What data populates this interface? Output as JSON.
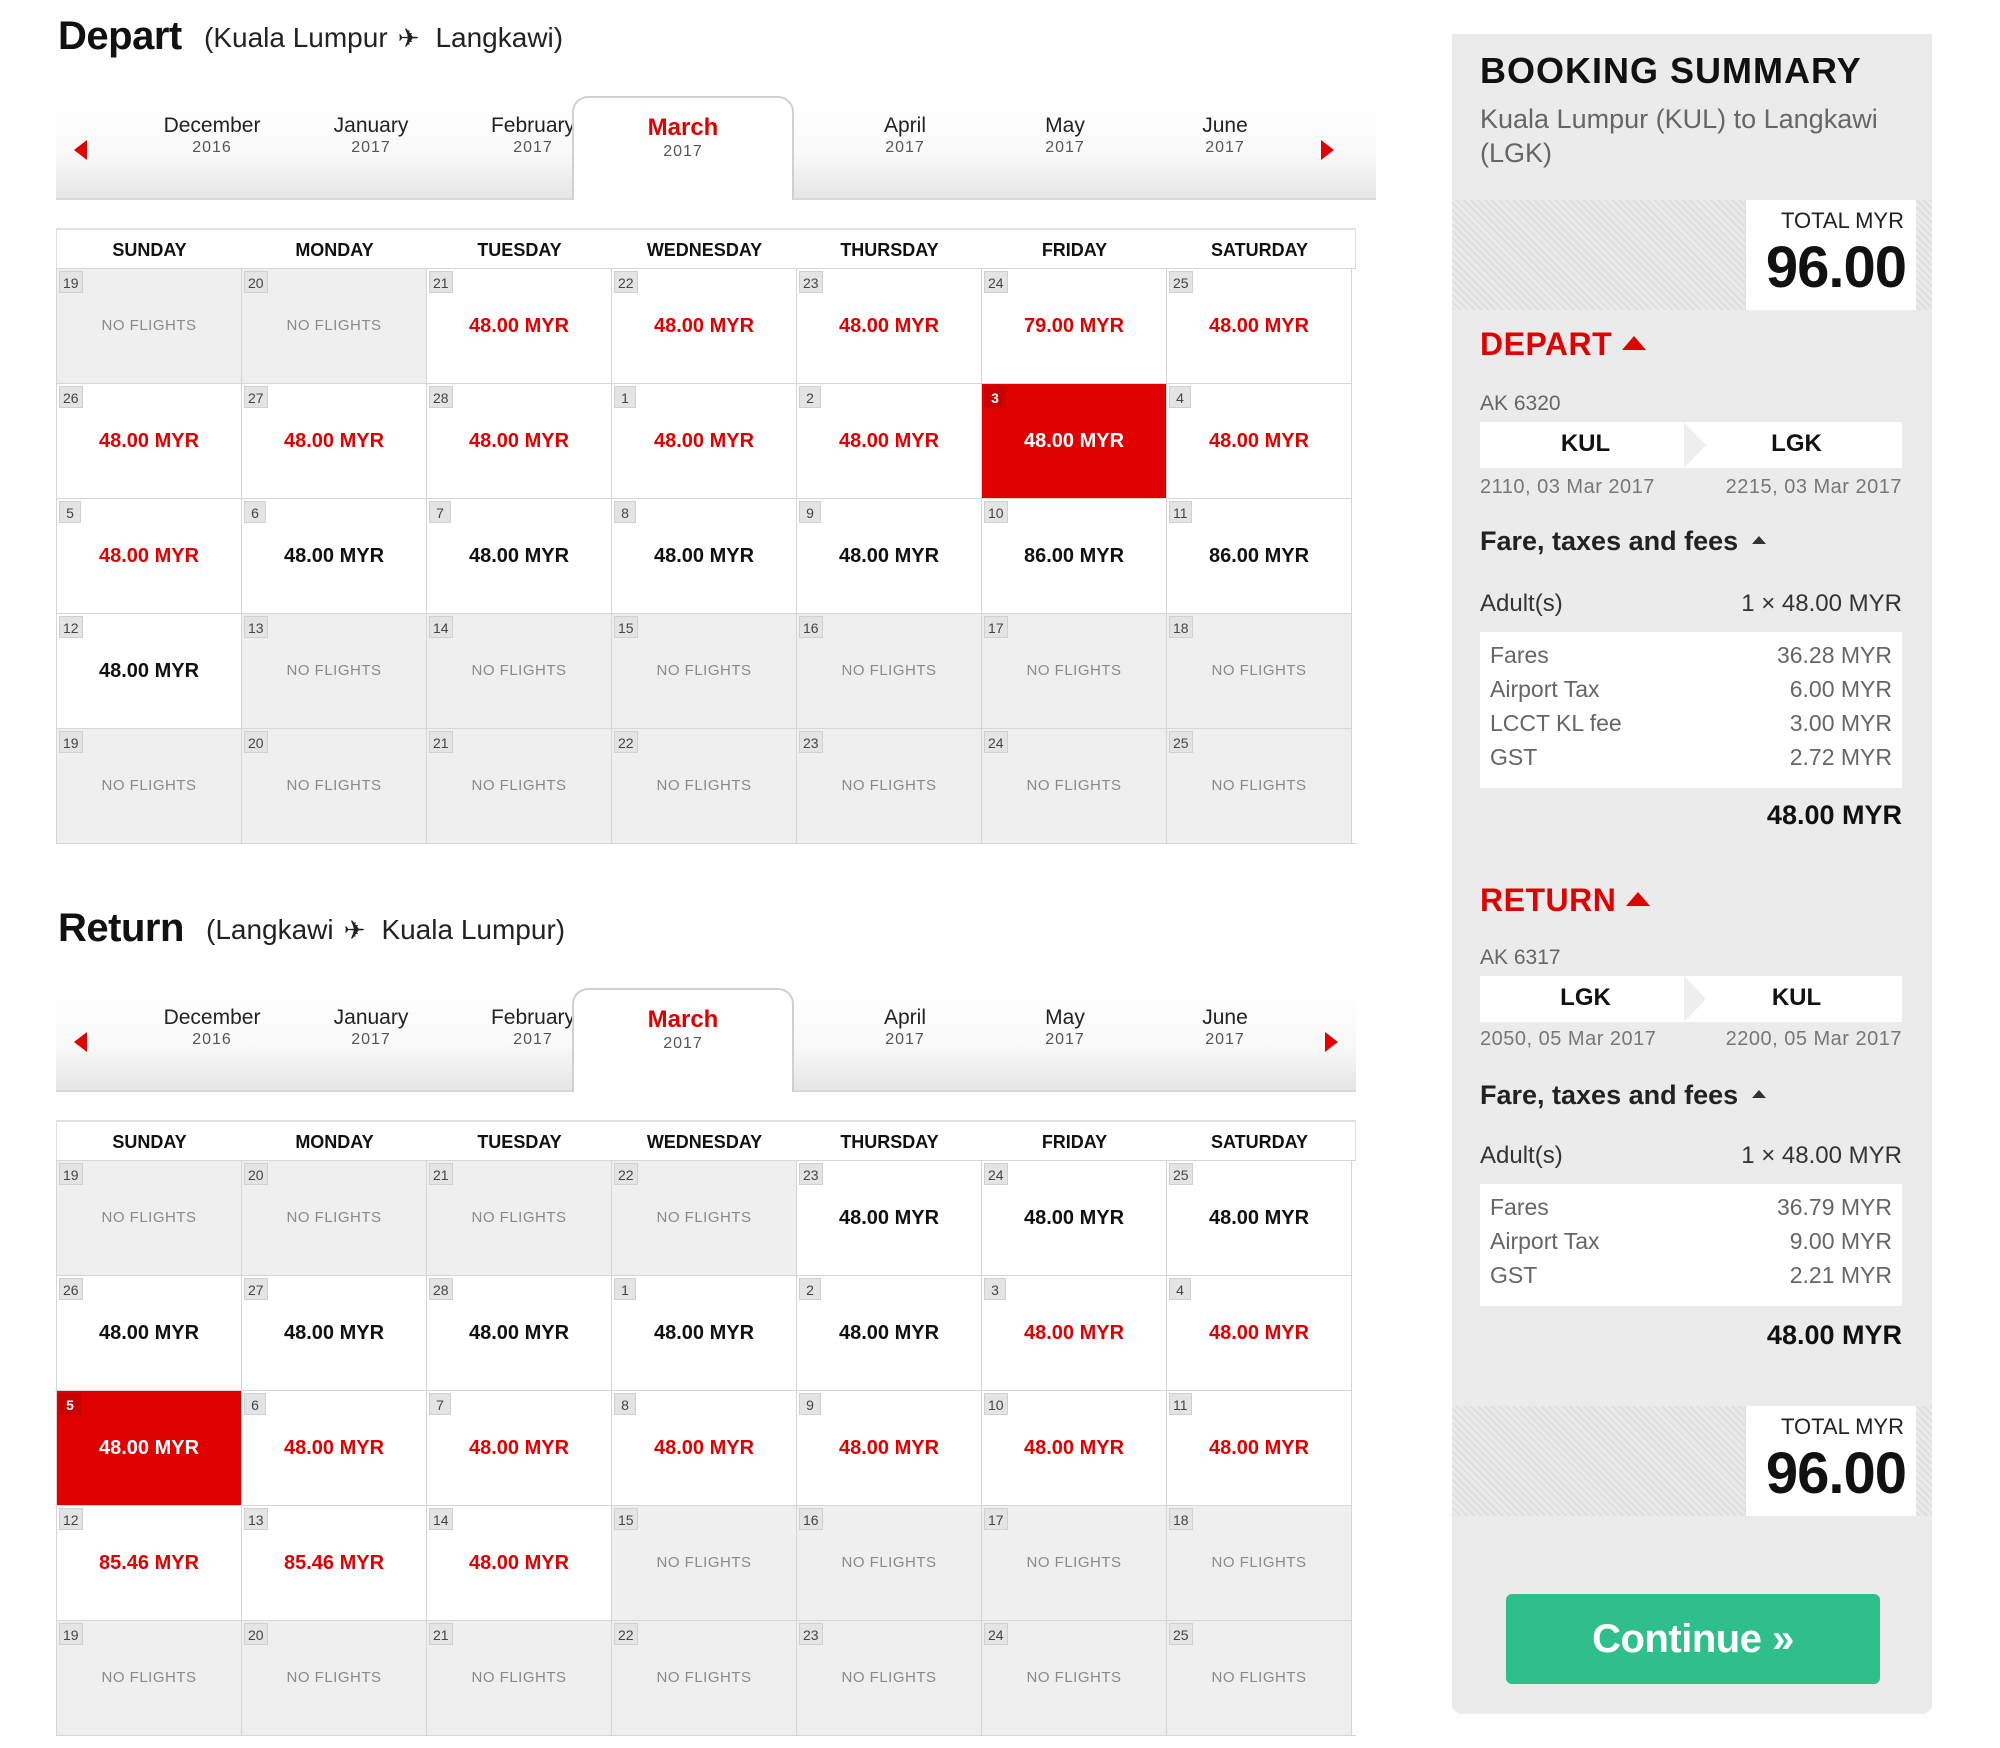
{
  "weekdays": [
    "SUNDAY",
    "MONDAY",
    "TUESDAY",
    "WEDNESDAY",
    "THURSDAY",
    "FRIDAY",
    "SATURDAY"
  ],
  "months": [
    {
      "name": "December",
      "year": "2016"
    },
    {
      "name": "January",
      "year": "2017"
    },
    {
      "name": "February",
      "year": "2017"
    },
    {
      "name": "March",
      "year": "2017",
      "active": true
    },
    {
      "name": "April",
      "year": "2017"
    },
    {
      "name": "May",
      "year": "2017"
    },
    {
      "name": "June",
      "year": "2017"
    }
  ],
  "no_flights_label": "NO FLIGHTS",
  "depart": {
    "title": "Depart",
    "route_from": "(Kuala Lumpur",
    "route_to": "Langkawi)",
    "cells": [
      {
        "day": "19",
        "price": null
      },
      {
        "day": "20",
        "price": null
      },
      {
        "day": "21",
        "price": "48.00 MYR",
        "tone": "red"
      },
      {
        "day": "22",
        "price": "48.00 MYR",
        "tone": "red"
      },
      {
        "day": "23",
        "price": "48.00 MYR",
        "tone": "red"
      },
      {
        "day": "24",
        "price": "79.00 MYR",
        "tone": "red"
      },
      {
        "day": "25",
        "price": "48.00 MYR",
        "tone": "red"
      },
      {
        "day": "26",
        "price": "48.00 MYR",
        "tone": "red"
      },
      {
        "day": "27",
        "price": "48.00 MYR",
        "tone": "red"
      },
      {
        "day": "28",
        "price": "48.00 MYR",
        "tone": "red"
      },
      {
        "day": "1",
        "price": "48.00 MYR",
        "tone": "red"
      },
      {
        "day": "2",
        "price": "48.00 MYR",
        "tone": "red"
      },
      {
        "day": "3",
        "price": "48.00 MYR",
        "tone": "sel"
      },
      {
        "day": "4",
        "price": "48.00 MYR",
        "tone": "red"
      },
      {
        "day": "5",
        "price": "48.00 MYR",
        "tone": "red"
      },
      {
        "day": "6",
        "price": "48.00 MYR",
        "tone": "blk"
      },
      {
        "day": "7",
        "price": "48.00 MYR",
        "tone": "blk"
      },
      {
        "day": "8",
        "price": "48.00 MYR",
        "tone": "blk"
      },
      {
        "day": "9",
        "price": "48.00 MYR",
        "tone": "blk"
      },
      {
        "day": "10",
        "price": "86.00 MYR",
        "tone": "blk"
      },
      {
        "day": "11",
        "price": "86.00 MYR",
        "tone": "blk"
      },
      {
        "day": "12",
        "price": "48.00 MYR",
        "tone": "blk"
      },
      {
        "day": "13",
        "price": null
      },
      {
        "day": "14",
        "price": null
      },
      {
        "day": "15",
        "price": null
      },
      {
        "day": "16",
        "price": null
      },
      {
        "day": "17",
        "price": null
      },
      {
        "day": "18",
        "price": null
      },
      {
        "day": "19",
        "price": null
      },
      {
        "day": "20",
        "price": null
      },
      {
        "day": "21",
        "price": null
      },
      {
        "day": "22",
        "price": null
      },
      {
        "day": "23",
        "price": null
      },
      {
        "day": "24",
        "price": null
      },
      {
        "day": "25",
        "price": null
      }
    ]
  },
  "return": {
    "title": "Return",
    "route_from": "(Langkawi",
    "route_to": "Kuala Lumpur)",
    "cells": [
      {
        "day": "19",
        "price": null
      },
      {
        "day": "20",
        "price": null
      },
      {
        "day": "21",
        "price": null
      },
      {
        "day": "22",
        "price": null
      },
      {
        "day": "23",
        "price": "48.00 MYR",
        "tone": "blk"
      },
      {
        "day": "24",
        "price": "48.00 MYR",
        "tone": "blk"
      },
      {
        "day": "25",
        "price": "48.00 MYR",
        "tone": "blk"
      },
      {
        "day": "26",
        "price": "48.00 MYR",
        "tone": "blk"
      },
      {
        "day": "27",
        "price": "48.00 MYR",
        "tone": "blk"
      },
      {
        "day": "28",
        "price": "48.00 MYR",
        "tone": "blk"
      },
      {
        "day": "1",
        "price": "48.00 MYR",
        "tone": "blk"
      },
      {
        "day": "2",
        "price": "48.00 MYR",
        "tone": "blk"
      },
      {
        "day": "3",
        "price": "48.00 MYR",
        "tone": "red"
      },
      {
        "day": "4",
        "price": "48.00 MYR",
        "tone": "red"
      },
      {
        "day": "5",
        "price": "48.00 MYR",
        "tone": "sel"
      },
      {
        "day": "6",
        "price": "48.00 MYR",
        "tone": "red"
      },
      {
        "day": "7",
        "price": "48.00 MYR",
        "tone": "red"
      },
      {
        "day": "8",
        "price": "48.00 MYR",
        "tone": "red"
      },
      {
        "day": "9",
        "price": "48.00 MYR",
        "tone": "red"
      },
      {
        "day": "10",
        "price": "48.00 MYR",
        "tone": "red"
      },
      {
        "day": "11",
        "price": "48.00 MYR",
        "tone": "red"
      },
      {
        "day": "12",
        "price": "85.46 MYR",
        "tone": "red"
      },
      {
        "day": "13",
        "price": "85.46 MYR",
        "tone": "red"
      },
      {
        "day": "14",
        "price": "48.00 MYR",
        "tone": "red"
      },
      {
        "day": "15",
        "price": null
      },
      {
        "day": "16",
        "price": null
      },
      {
        "day": "17",
        "price": null
      },
      {
        "day": "18",
        "price": null
      },
      {
        "day": "19",
        "price": null
      },
      {
        "day": "20",
        "price": null
      },
      {
        "day": "21",
        "price": null
      },
      {
        "day": "22",
        "price": null
      },
      {
        "day": "23",
        "price": null
      },
      {
        "day": "24",
        "price": null
      },
      {
        "day": "25",
        "price": null
      }
    ]
  },
  "summary": {
    "title": "BOOKING SUMMARY",
    "route": "Kuala Lumpur (KUL) to Langkawi (LGK)",
    "total_label": "TOTAL MYR",
    "total_value": "96.00",
    "depart": {
      "heading": "DEPART",
      "flight_no": "AK 6320",
      "from": "KUL",
      "to": "LGK",
      "dep_time": "2110, 03 Mar 2017",
      "arr_time": "2215, 03 Mar 2017",
      "fare_heading": "Fare, taxes and fees",
      "adult_label": "Adult(s)",
      "adult_value": "1 × 48.00 MYR",
      "breakdown": [
        {
          "label": "Fares",
          "value": "36.28 MYR"
        },
        {
          "label": "Airport Tax",
          "value": "6.00 MYR"
        },
        {
          "label": "LCCT KL fee",
          "value": "3.00 MYR"
        },
        {
          "label": "GST",
          "value": "2.72 MYR"
        }
      ],
      "total": "48.00 MYR"
    },
    "return": {
      "heading": "RETURN",
      "flight_no": "AK 6317",
      "from": "LGK",
      "to": "KUL",
      "dep_time": "2050, 05 Mar 2017",
      "arr_time": "2200, 05 Mar 2017",
      "fare_heading": "Fare, taxes and fees",
      "adult_label": "Adult(s)",
      "adult_value": "1 × 48.00 MYR",
      "breakdown": [
        {
          "label": "Fares",
          "value": "36.79 MYR"
        },
        {
          "label": "Airport Tax",
          "value": "9.00 MYR"
        },
        {
          "label": "GST",
          "value": "2.21 MYR"
        }
      ],
      "total": "48.00 MYR"
    },
    "continue_label": "Continue »"
  },
  "colors": {
    "accent": "#e00000",
    "continue": "#2fbf8a",
    "no_flight_bg": "#efefef"
  }
}
